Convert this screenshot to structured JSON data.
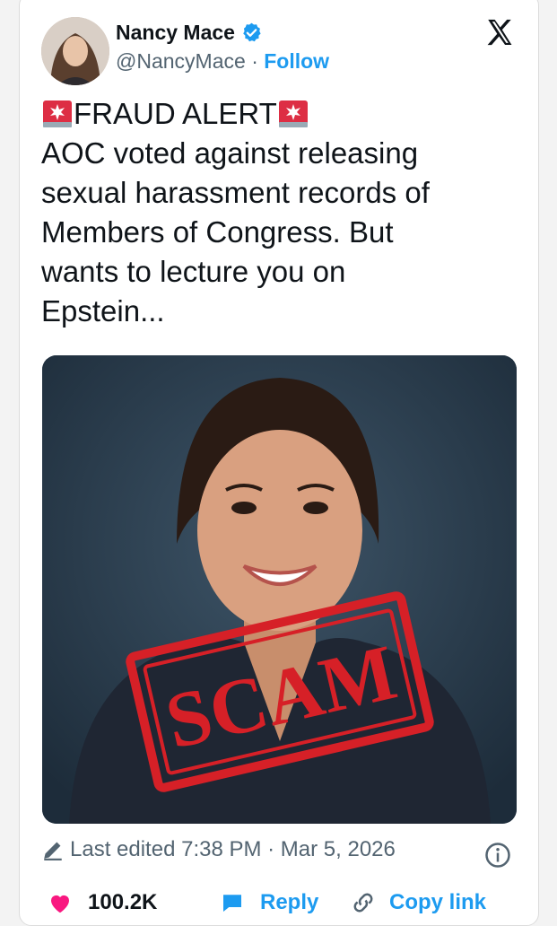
{
  "author": {
    "name": "Nancy Mace",
    "handle": "@NancyMace",
    "separator": "·",
    "follow_label": "Follow",
    "verified_color": "#1d9bf0"
  },
  "tweet": {
    "lines": [
      "FRAUD ALERT",
      "AOC voted against releasing",
      "sexual harassment records of",
      "Members of Congress. But",
      "wants to lecture you on",
      "Epstein..."
    ],
    "emoji": "police-car-light"
  },
  "media": {
    "stamp_text": "SCAM",
    "stamp_color": "#d62027"
  },
  "meta": {
    "edited_label": "Last edited 7:38 PM · Mar 5, 2026"
  },
  "actions": {
    "likes": "100.2K",
    "reply_label": "Reply",
    "copy_link_label": "Copy link"
  }
}
